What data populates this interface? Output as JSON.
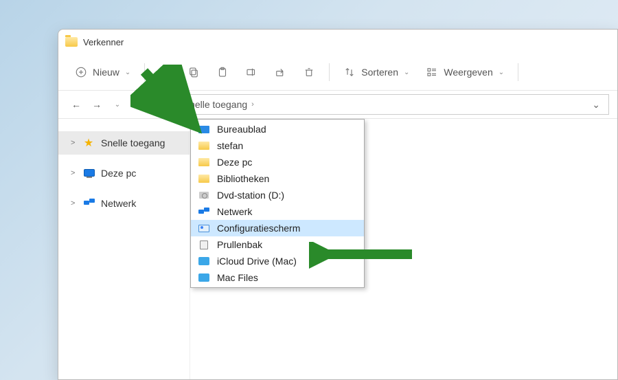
{
  "window": {
    "title": "Verkenner"
  },
  "toolbar": {
    "new_label": "Nieuw",
    "sort_label": "Sorteren",
    "view_label": "Weergeven"
  },
  "breadcrumb": {
    "current": "Snelle toegang"
  },
  "sidebar": {
    "items": [
      {
        "label": "Snelle toegang",
        "icon": "star",
        "selected": true,
        "expander": ">"
      },
      {
        "label": "Deze pc",
        "icon": "pc",
        "selected": false,
        "expander": ">"
      },
      {
        "label": "Netwerk",
        "icon": "network",
        "selected": false,
        "expander": ">"
      }
    ]
  },
  "dropdown": {
    "items": [
      {
        "label": "Bureaublad",
        "icon": "desktop"
      },
      {
        "label": "stefan",
        "icon": "folder"
      },
      {
        "label": "Deze pc",
        "icon": "folder"
      },
      {
        "label": "Bibliotheken",
        "icon": "folder"
      },
      {
        "label": "Dvd-station (D:)",
        "icon": "dvd"
      },
      {
        "label": "Netwerk",
        "icon": "network"
      },
      {
        "label": "Configuratiescherm",
        "icon": "controlpanel",
        "highlighted": true
      },
      {
        "label": "Prullenbak",
        "icon": "trash"
      },
      {
        "label": "iCloud Drive (Mac)",
        "icon": "icloud"
      },
      {
        "label": "Mac Files",
        "icon": "mac"
      }
    ]
  }
}
